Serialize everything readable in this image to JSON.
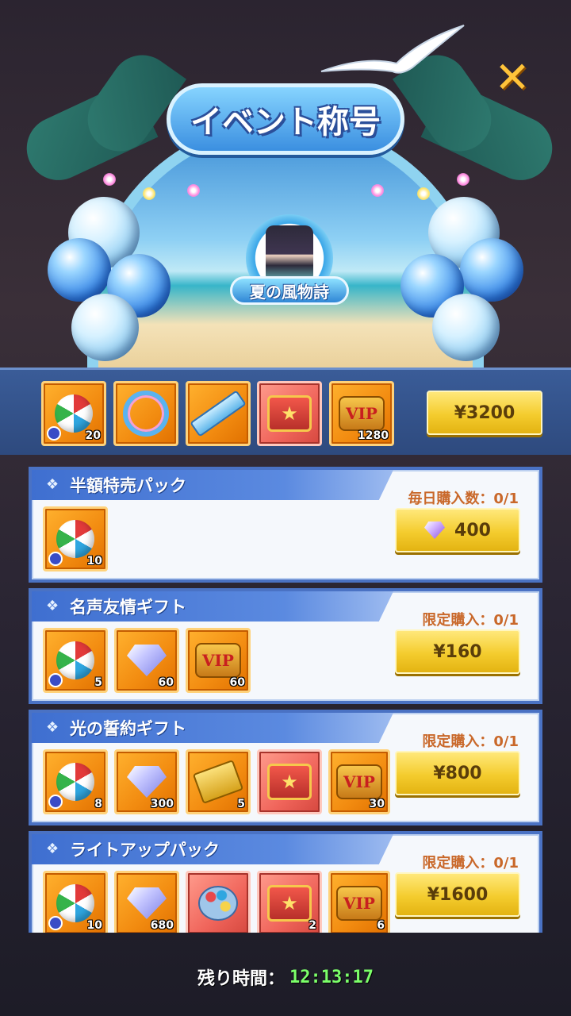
{
  "header": {
    "title": "イベント称号",
    "close_icon": "close-icon",
    "badge_label": "夏の風物詩"
  },
  "main_pack": {
    "items": [
      {
        "icon": "beach-ball-icon",
        "qty": "20",
        "timed": true
      },
      {
        "icon": "title-frame-ring-icon",
        "qty": ""
      },
      {
        "icon": "title-plate-icon",
        "qty": ""
      },
      {
        "icon": "treasure-chest-icon",
        "qty": ""
      },
      {
        "icon": "vip-badge-icon",
        "qty": "1280"
      }
    ],
    "price": "¥3200"
  },
  "packs": [
    {
      "name": "半額特売パック",
      "limit": "毎日購入数：0/1",
      "price": "400",
      "currency_icon": "gem-icon",
      "items": [
        {
          "icon": "beach-ball-icon",
          "qty": "10",
          "timed": true
        }
      ]
    },
    {
      "name": "名声友情ギフト",
      "limit": "限定購入：0/1",
      "price": "¥160",
      "items": [
        {
          "icon": "beach-ball-icon",
          "qty": "5",
          "timed": true
        },
        {
          "icon": "diamond-gem-icon",
          "qty": "60"
        },
        {
          "icon": "vip-badge-icon",
          "qty": "60"
        }
      ]
    },
    {
      "name": "光の誓約ギフト",
      "limit": "限定購入：0/1",
      "price": "¥800",
      "items": [
        {
          "icon": "beach-ball-icon",
          "qty": "8",
          "timed": true
        },
        {
          "icon": "diamond-gem-icon",
          "qty": "300"
        },
        {
          "icon": "golden-ticket-icon",
          "qty": "5"
        },
        {
          "icon": "treasure-chest-icon",
          "qty": ""
        },
        {
          "icon": "vip-badge-icon",
          "qty": "30"
        }
      ]
    },
    {
      "name": "ライトアップパック",
      "limit": "限定購入：0/1",
      "price": "¥1600",
      "items": [
        {
          "icon": "beach-ball-icon",
          "qty": "10",
          "timed": true
        },
        {
          "icon": "diamond-gem-icon",
          "qty": "680"
        },
        {
          "icon": "paint-palette-icon",
          "qty": ""
        },
        {
          "icon": "treasure-chest-icon",
          "qty": "2"
        },
        {
          "icon": "vip-badge-icon",
          "qty": "6"
        }
      ]
    }
  ],
  "footer": {
    "label": "残り時間：",
    "time": "12:13:17"
  },
  "colors": {
    "accent_blue": "#4a72c4",
    "gold_button": "#f4cc2e",
    "limit_text": "#c9682a",
    "timer_green": "#7cff6a"
  }
}
